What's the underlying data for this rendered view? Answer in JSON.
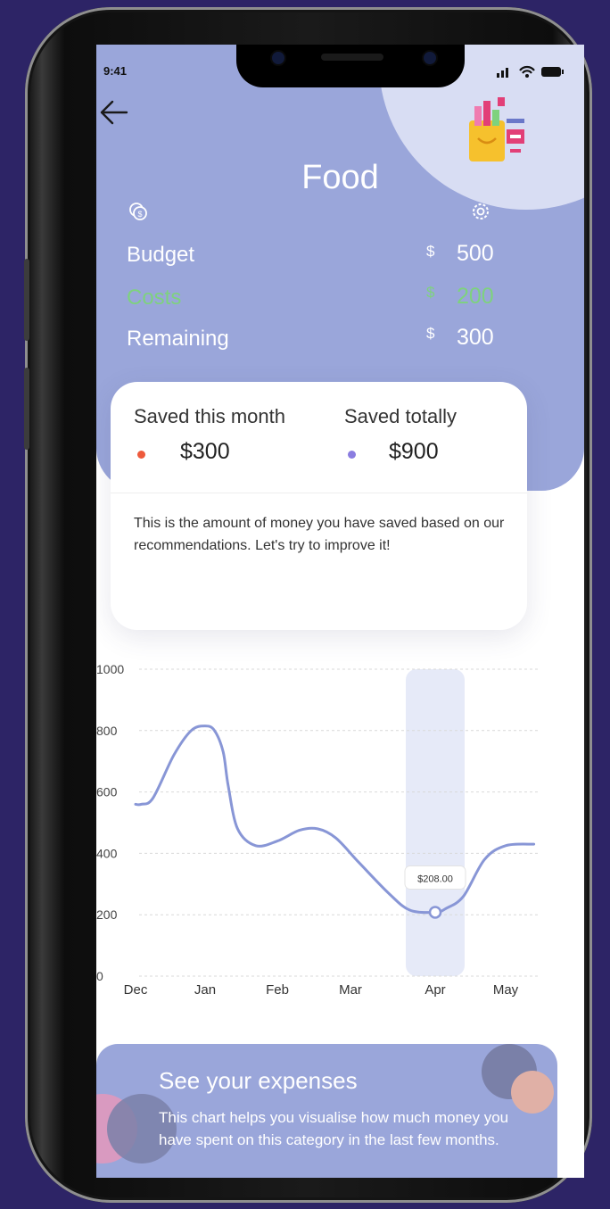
{
  "status": {
    "time": "9:41"
  },
  "header": {
    "title": "Food",
    "budget_label": "Budget",
    "budget_currency": "$",
    "budget_value": "500",
    "costs_label": "Costs",
    "costs_currency": "$",
    "costs_value": "200",
    "remaining_label": "Remaining",
    "remaining_currency": "$",
    "remaining_value": "300"
  },
  "savings_card": {
    "month_label": "Saved this month",
    "month_value": "$300",
    "total_label": "Saved totally",
    "total_value": "$900",
    "description": "This is the amount of money you have saved based on our recommendations. Let's try to improve it!"
  },
  "chart_data": {
    "type": "line",
    "categories": [
      "Dec",
      "Jan",
      "Feb",
      "Mar",
      "Apr",
      "May"
    ],
    "x": [
      0,
      0.08,
      0.25,
      0.55,
      0.8,
      1.0,
      1.13,
      1.25,
      1.32,
      1.45,
      1.7,
      2.0,
      2.3,
      2.55,
      2.8,
      3.1,
      3.45,
      3.7,
      4.0,
      4.15,
      4.4,
      4.7,
      5.0,
      5.4
    ],
    "values": [
      560,
      560,
      580,
      720,
      800,
      815,
      800,
      730,
      620,
      480,
      425,
      440,
      475,
      480,
      450,
      370,
      270,
      215,
      208,
      220,
      260,
      380,
      425,
      430
    ],
    "yticks": [
      0,
      200,
      400,
      600,
      800,
      1000
    ],
    "ylim": [
      0,
      1000
    ],
    "highlight": {
      "category": "Apr",
      "label": "$208.00",
      "value": 208
    },
    "line_color": "#8896d6",
    "highlight_color": "#e6eaf8",
    "grid": true
  },
  "promo": {
    "title": "See your expenses",
    "text": "This chart helps you visualise how much money you have spent on this category in the last few months."
  },
  "colors": {
    "background": "#2d2466",
    "header": "#9aa6da",
    "costs_green": "#7ed27e",
    "dot_month": "#ee5a3c",
    "dot_total": "#8a7de0"
  }
}
